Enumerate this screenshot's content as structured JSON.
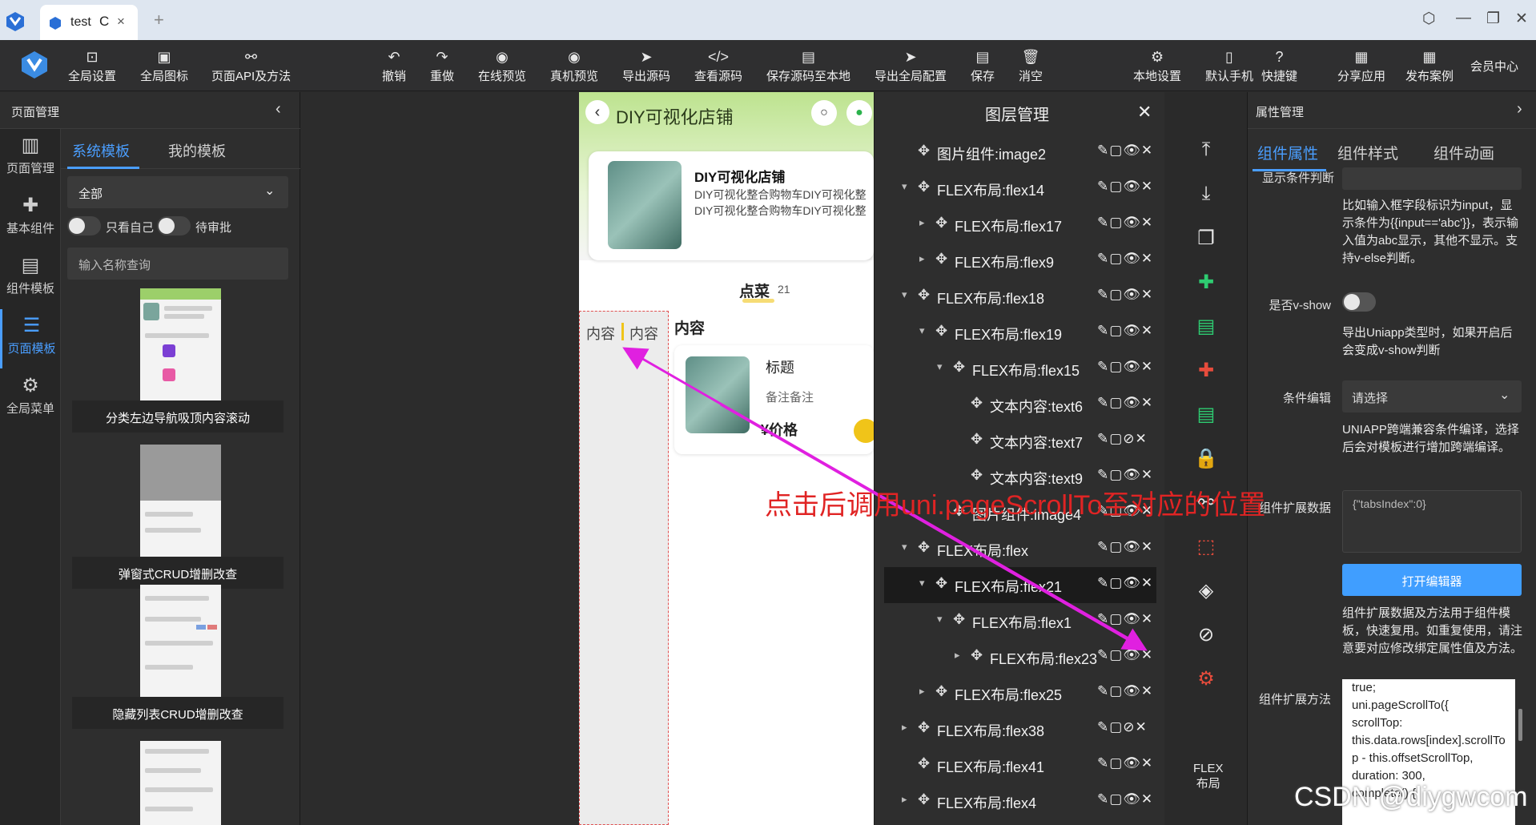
{
  "browser": {
    "tab_title": "test",
    "reload_glyph": "C",
    "close_glyph": "×",
    "new_tab_glyph": "+"
  },
  "toolbar": {
    "left": [
      {
        "label": "全局设置",
        "icon": "settings-window-icon",
        "glyph": "⊡"
      },
      {
        "label": "全局图标",
        "icon": "image-icon",
        "glyph": "▣"
      },
      {
        "label": "页面API及方法",
        "icon": "api-link-icon",
        "glyph": "⚯"
      }
    ],
    "center": [
      {
        "label": "撤销",
        "icon": "undo-icon",
        "glyph": "↶"
      },
      {
        "label": "重做",
        "icon": "redo-icon",
        "glyph": "↷"
      },
      {
        "label": "在线预览",
        "icon": "eye-icon",
        "glyph": "◉"
      },
      {
        "label": "真机预览",
        "icon": "eye-icon",
        "glyph": "◉"
      },
      {
        "label": "导出源码",
        "icon": "send-icon",
        "glyph": "➤"
      },
      {
        "label": "查看源码",
        "icon": "code-icon",
        "glyph": "</>"
      },
      {
        "label": "保存源码至本地",
        "icon": "save-icon",
        "glyph": "▤"
      },
      {
        "label": "导出全局配置",
        "icon": "send-icon",
        "glyph": "➤"
      },
      {
        "label": "保存",
        "icon": "save-icon",
        "glyph": "▤"
      },
      {
        "label": "消空",
        "icon": "trash-icon",
        "glyph": "🗑"
      }
    ],
    "right": [
      {
        "label": "本地设置",
        "icon": "gear-icon",
        "glyph": "⚙"
      },
      {
        "label": "默认手机",
        "icon": "phone-icon",
        "glyph": "▯"
      },
      {
        "label": "快捷键",
        "icon": "help-icon",
        "glyph": "?"
      },
      {
        "label": "分享应用",
        "icon": "share-icon",
        "glyph": "▦"
      },
      {
        "label": "发布案例",
        "icon": "publish-icon",
        "glyph": "▦"
      }
    ],
    "member_center": "会员中心"
  },
  "left_panel": {
    "title": "页面管理",
    "collapse_glyph": "‹",
    "nav": [
      {
        "label": "页面管理",
        "icon": "layout-icon",
        "glyph": "▥"
      },
      {
        "label": "基本组件",
        "icon": "puzzle-icon",
        "glyph": "✚"
      },
      {
        "label": "组件模板",
        "icon": "component-template-icon",
        "glyph": "▤"
      },
      {
        "label": "页面模板",
        "icon": "database-icon",
        "glyph": "☰"
      },
      {
        "label": "全局菜单",
        "icon": "gear-icon",
        "glyph": "⚙"
      }
    ],
    "tabs": [
      "系统模板",
      "我的模板"
    ],
    "filter_value": "全部",
    "only_mine_label": "只看自己",
    "pending_label": "待审批",
    "search_placeholder": "输入名称查询",
    "templates": [
      "分类左边导航吸顶内容滚动",
      "弹窗式CRUD增删改查",
      "隐藏列表CRUD增删改查"
    ]
  },
  "phone_preview": {
    "title": "DIY可视化店铺",
    "back_glyph": "‹",
    "search_glyph": "○",
    "wechat_glyph": "●",
    "shop_name": "DIY可视化店铺",
    "shop_desc_lines": [
      "DIY可视化整合购物车DIY可视化整",
      "DIY可视化整合购物车DIY可视化整"
    ],
    "tab_label": "点菜",
    "tab_count": "21",
    "side_items": [
      "内容",
      "内容"
    ],
    "section_title": "内容",
    "item_title": "标题",
    "item_note": "备注备注",
    "item_price": "¥价格"
  },
  "layers": {
    "title": "图层管理",
    "close_glyph": "✕",
    "move_glyph": "✥",
    "actions_visible": "✎▢👁✕",
    "actions_hidden": "✎▢⊘✕",
    "items": [
      {
        "label": "图片组件:image2",
        "depth": 0,
        "arrow": ""
      },
      {
        "label": "FLEX布局:flex14",
        "depth": 0,
        "arrow": "▾"
      },
      {
        "label": "FLEX布局:flex17",
        "depth": 1,
        "arrow": "▸"
      },
      {
        "label": "FLEX布局:flex9",
        "depth": 1,
        "arrow": "▸"
      },
      {
        "label": "FLEX布局:flex18",
        "depth": 0,
        "arrow": "▾"
      },
      {
        "label": "FLEX布局:flex19",
        "depth": 1,
        "arrow": "▾"
      },
      {
        "label": "FLEX布局:flex15",
        "depth": 2,
        "arrow": "▾"
      },
      {
        "label": "文本内容:text6",
        "depth": 3,
        "arrow": ""
      },
      {
        "label": "文本内容:text7",
        "depth": 3,
        "arrow": "",
        "hidden": true
      },
      {
        "label": "文本内容:text9",
        "depth": 3,
        "arrow": ""
      },
      {
        "label": "图片组件:image4",
        "depth": 2,
        "arrow": ""
      },
      {
        "label": "FLEX布局:flex",
        "depth": 0,
        "arrow": "▾"
      },
      {
        "label": "FLEX布局:flex21",
        "depth": 1,
        "arrow": "▾",
        "selected": true
      },
      {
        "label": "FLEX布局:flex1",
        "depth": 2,
        "arrow": "▾"
      },
      {
        "label": "FLEX布局:flex23",
        "depth": 3,
        "arrow": "▸"
      },
      {
        "label": "FLEX布局:flex25",
        "depth": 1,
        "arrow": "▸"
      },
      {
        "label": "FLEX布局:flex38",
        "depth": 0,
        "arrow": "▸",
        "hidden": true
      },
      {
        "label": "FLEX布局:flex41",
        "depth": 0,
        "arrow": ""
      },
      {
        "label": "FLEX布局:flex4",
        "depth": 0,
        "arrow": "▸"
      }
    ]
  },
  "icon_strip": {
    "items": [
      {
        "icon": "arrow-to-top-icon",
        "glyph": "⤒",
        "color": "#e8e8e8"
      },
      {
        "icon": "download-icon",
        "glyph": "⤓",
        "color": "#e8e8e8"
      },
      {
        "icon": "copy-icon",
        "glyph": "❐",
        "color": "#e8e8e8"
      },
      {
        "icon": "green-puzzle-icon",
        "glyph": "✚",
        "color": "#2ecc71"
      },
      {
        "icon": "green-doc-icon",
        "glyph": "▤",
        "color": "#2ecc71"
      },
      {
        "icon": "red-puzzle-icon",
        "glyph": "✚",
        "color": "#e74c3c"
      },
      {
        "icon": "green-doc-add-icon",
        "glyph": "▤",
        "color": "#2ecc71"
      },
      {
        "icon": "lock-icon",
        "glyph": "🔒",
        "color": "#e8e8e8"
      },
      {
        "icon": "link-icon",
        "glyph": "⚯",
        "color": "#e8e8e8"
      },
      {
        "icon": "red-dashed-box-icon",
        "glyph": "⬚",
        "color": "#e74c3c"
      },
      {
        "icon": "layers-icon",
        "glyph": "◈",
        "color": "#e8e8e8"
      },
      {
        "icon": "hide-icon",
        "glyph": "⊘",
        "color": "#e8e8e8"
      },
      {
        "icon": "red-gear-icon",
        "glyph": "⚙",
        "color": "#e74c3c"
      }
    ],
    "flex_label_1": "FLEX",
    "flex_label_2": "布局"
  },
  "right_panel": {
    "title": "属性管理",
    "collapse_glyph": "›",
    "tabs": [
      "组件属性",
      "组件样式",
      "组件动画"
    ],
    "condition_label": "显示条件判断",
    "condition_desc": "比如输入框字段标识为input，显示条件为{{input=='abc'}}，表示输入值为abc显示，其他不显示。支持v-else判断。",
    "vshow_label": "是否v-show",
    "vshow_desc": "导出Uniapp类型时，如果开启后会变成v-show判断",
    "cond_edit_label": "条件编辑",
    "cond_edit_placeholder": "请选择",
    "uniapp_desc": "UNIAPP跨端兼容条件编译，选择后会对模板进行增加跨端编译。",
    "ext_data_label": "组件扩展数据",
    "ext_data_value": "{\"tabsIndex\":0}",
    "open_editor_button": "打开编辑器",
    "ext_desc": "组件扩展数据及方法用于组件模板，快速复用。如重复使用，请注意要对应修改绑定属性值及方法。",
    "ext_method_label": "组件扩展方法",
    "code_lines": [
      "true;",
      "      uni.pageScrollTo({",
      "        scrollTop:",
      "this.data.rows[index].scrollTo",
      "p - this.offsetScrollTop,",
      "        duration: 300,",
      "        complete() {"
    ]
  },
  "annotation": "点击后调用uni.pageScrollTo至对应的位置",
  "watermark": "CSDN @diygwcom",
  "colors": {
    "accent": "#409eff",
    "annotation": "#e02424",
    "arrow": "#e020e0"
  }
}
